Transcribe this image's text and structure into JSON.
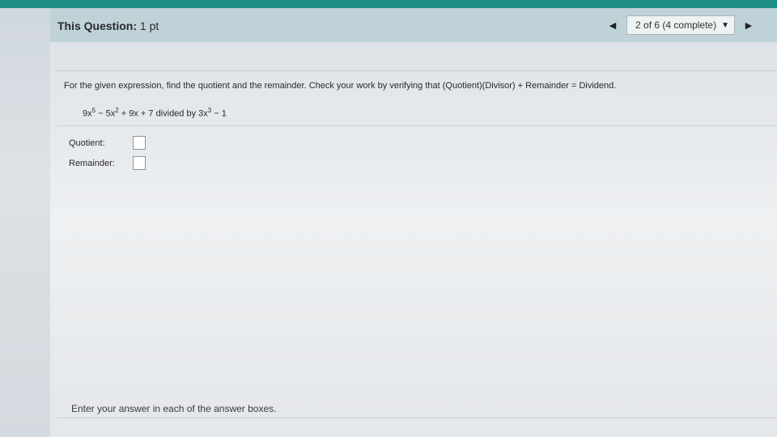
{
  "header": {
    "question_label": "This Question:",
    "question_points": "1 pt",
    "nav": {
      "progress_text": "2 of 6 (4 complete)"
    }
  },
  "question": {
    "instruction": "For the given expression, find the quotient and the remainder. Check your work by verifying that (Quotient)(Divisor) + Remainder = Dividend.",
    "expression": {
      "dividend_parts": [
        "9x",
        "5",
        " − 5x",
        "2",
        " + 9x + 7"
      ],
      "connector": "divided by",
      "divisor_parts": [
        "3x",
        "3",
        " − 1"
      ]
    },
    "answers": {
      "quotient_label": "Quotient:",
      "remainder_label": "Remainder:"
    }
  },
  "footer": {
    "hint": "Enter your answer in each of the answer boxes."
  },
  "colors": {
    "top_bar": "#1f8f86",
    "header_bg": "#bfd2d8"
  },
  "icons": {
    "prev": "triangle-left",
    "dropdown": "triangle-down",
    "next": "triangle-right"
  }
}
